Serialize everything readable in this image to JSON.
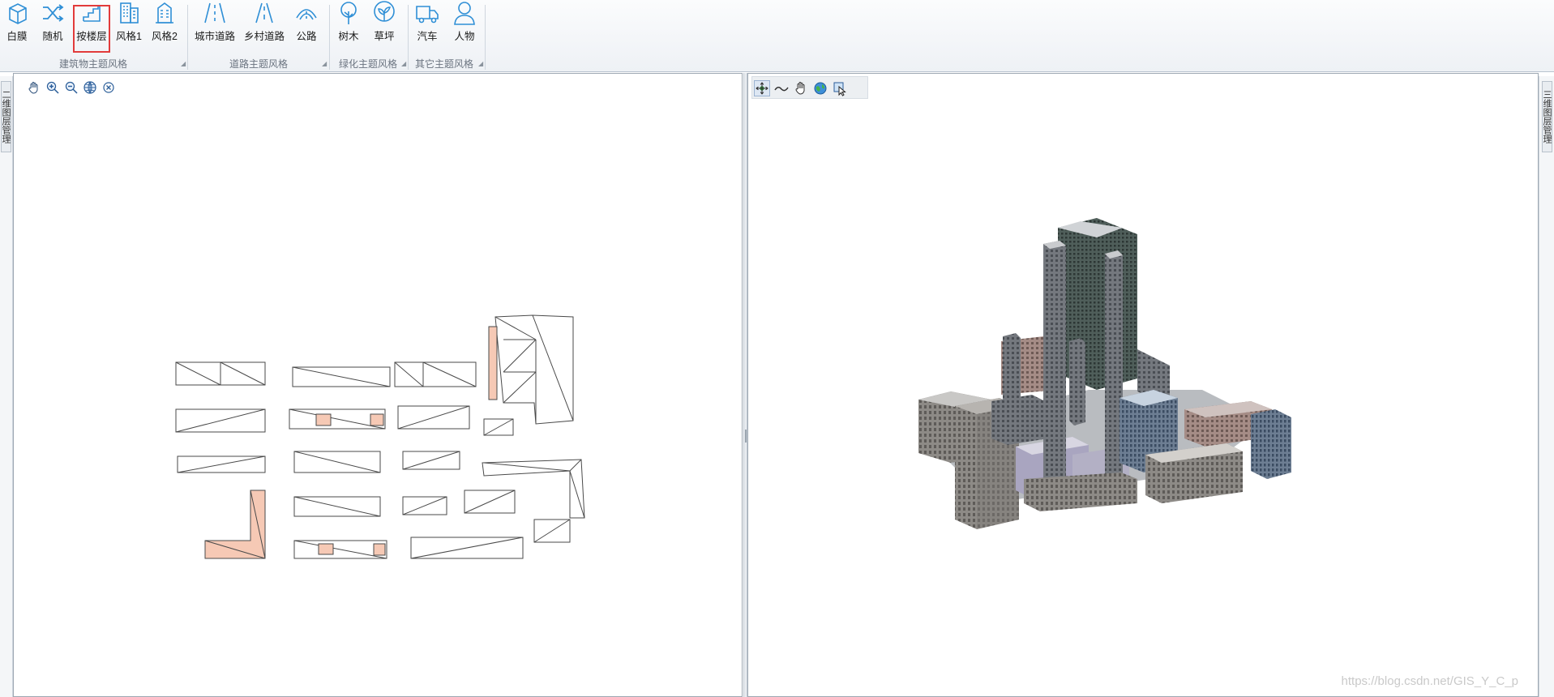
{
  "ribbon": {
    "groups": [
      {
        "label": "建筑物主题风格",
        "buttons": [
          {
            "label": "白膜"
          },
          {
            "label": "随机"
          },
          {
            "label": "按楼层"
          },
          {
            "label": "风格1"
          },
          {
            "label": "风格2"
          }
        ]
      },
      {
        "label": "道路主题风格",
        "buttons": [
          {
            "label": "城市道路"
          },
          {
            "label": "乡村道路"
          },
          {
            "label": "公路"
          }
        ]
      },
      {
        "label": "绿化主题风格",
        "buttons": [
          {
            "label": "树木"
          },
          {
            "label": "草坪"
          }
        ]
      },
      {
        "label": "其它主题风格",
        "buttons": [
          {
            "label": "汽车"
          },
          {
            "label": "人物"
          }
        ]
      }
    ],
    "selected_button": "按楼层"
  },
  "side_tabs": {
    "left": "二维图层管理",
    "right": "三维图层管理"
  },
  "map2d_toolbar": [
    {
      "icon": "pan-hand-icon"
    },
    {
      "icon": "zoom-in-icon"
    },
    {
      "icon": "zoom-out-icon"
    },
    {
      "icon": "full-extent-globe-icon"
    },
    {
      "icon": "clear-icon"
    }
  ],
  "scene3d_toolbar": [
    {
      "icon": "navigate-icon"
    },
    {
      "icon": "fly-path-icon"
    },
    {
      "icon": "pan-hand-icon"
    },
    {
      "icon": "globe-icon"
    },
    {
      "icon": "select-icon"
    }
  ],
  "colors": {
    "accent_blue": "#2f8fd6",
    "highlight_red": "#e23b3b",
    "footprint_fill": "#f6c9b5",
    "building_gray": "#6f7378"
  },
  "watermark": "https://blog.csdn.net/GIS_Y_C_p"
}
